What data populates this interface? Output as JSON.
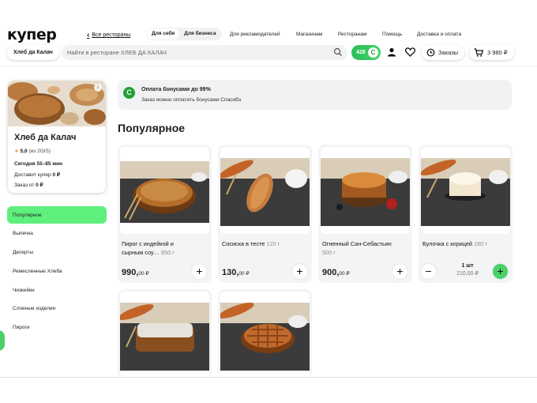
{
  "header": {
    "logo": "купер",
    "back_label": "Все рестораны",
    "segments": [
      "Для себя",
      "Для бизнеса"
    ],
    "nav": [
      "Для рекламодателей",
      "Магазинам",
      "Ресторанам",
      "Помощь",
      "Доставка и оплата"
    ],
    "store_pill": "Хлеб да Калач",
    "search_placeholder": "Найти в ресторане ХЛЕБ ДА КАЛАЧ",
    "bonus_points": "428",
    "bonus_badge": "С",
    "orders_label": "Заказы",
    "cart_total": "3 980 ₽"
  },
  "store": {
    "name": "Хлеб да Калач",
    "rating": "5,0",
    "rating_source": "(из 2GIS)",
    "time": "Сегодня 55–85 мин",
    "delivery_label": "Доставит купер",
    "delivery_value": "0 ₽",
    "min_order_label": "Заказ от",
    "min_order_value": "0 ₽"
  },
  "categories": [
    "Популярное",
    "Выпечка",
    "Десерты",
    "Ремесленные Хлеба",
    "Чизкейки",
    "Слоеные изделия",
    "Пироги"
  ],
  "banner": {
    "icon_letter": "С",
    "title": "Оплата бонусами до 99%",
    "text": "Заказ можно оплатить бонусами Спасибо"
  },
  "section_title": "Популярное",
  "products": [
    {
      "name": "Пирог с индейкой и сырным соу…",
      "weight": "850 г",
      "price_main": "990,",
      "price_cents": "00 ₽"
    },
    {
      "name": "Сосиска в тесте",
      "weight": "120 г",
      "price_main": "130,",
      "price_cents": "00 ₽"
    },
    {
      "name": "Огненный Сан-Себастьян",
      "weight": "500 г",
      "price_main": "900,",
      "price_cents": "00 ₽"
    },
    {
      "name": "Булочка с корицей",
      "weight": "180 г",
      "qty": "1 шт",
      "price_total": "210,00 ₽"
    }
  ],
  "colors": {
    "accent": "#4ad167",
    "brand_green": "#21a038",
    "active_category": "#5fef7c"
  }
}
